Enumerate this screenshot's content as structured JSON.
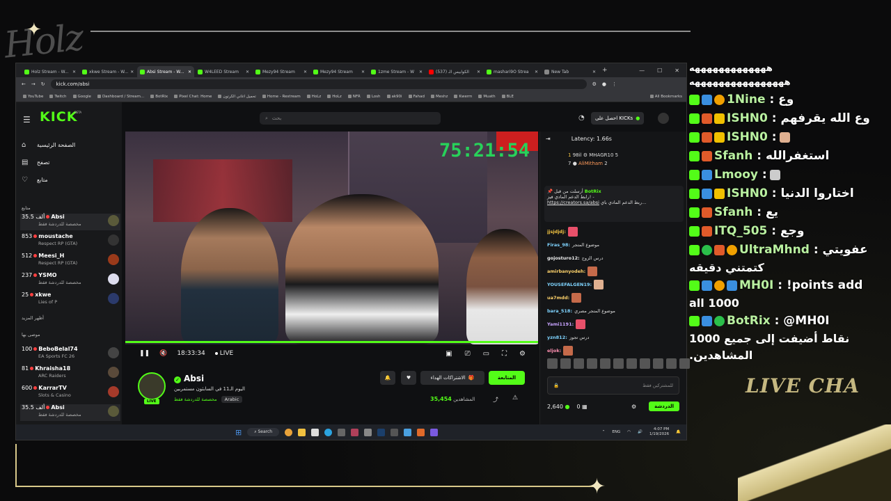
{
  "overlay_logo": "Holz",
  "browser": {
    "tabs": [
      {
        "label": "Holz Stream - W..."
      },
      {
        "label": "xkwe Stream - W..."
      },
      {
        "label": "Absi Stream - W...",
        "active": true
      },
      {
        "label": "W4LEED Stream"
      },
      {
        "label": "Mezy94 Stream"
      },
      {
        "label": "Mezy94 Stream"
      },
      {
        "label": "1zme Stream - W"
      },
      {
        "label": "الكوابيس الـ (537)"
      },
      {
        "label": "mashari9O Strea"
      },
      {
        "label": "New Tab"
      }
    ],
    "url": "kick.com/absi",
    "bookmarks": [
      "YouTube",
      "Twitch",
      "Google",
      "Dashboard / Stream...",
      "BotRix",
      "Pixel Chat: Home",
      "تحميل اغاني الكرتون",
      "Home - Restream",
      "HoLz",
      "HoLz",
      "NFR",
      "Losh",
      "ak90i",
      "Fahad",
      "Meshz",
      "Kwerm",
      "Muath",
      "BLE"
    ],
    "all_bookmarks": "All Bookmarks"
  },
  "kick": {
    "logo": "KICK",
    "beta": "BETA",
    "search_placeholder": "بحث",
    "kicks_button": "احصل على KICKs",
    "nav": [
      {
        "label": "الصفحة الرئيسية",
        "icon": "home-icon"
      },
      {
        "label": "تصفح",
        "icon": "browse-icon"
      },
      {
        "label": "متابع",
        "icon": "heart-icon"
      }
    ],
    "following_label": "متابع",
    "show_more": "أظهر المزيد",
    "recommended_label": "موصى بها",
    "following": [
      {
        "count": "35.5 ألف",
        "name": "Absi",
        "sub": "مخصصة للدردشة فقط"
      },
      {
        "count": "853",
        "name": "moustache",
        "sub": "Respect RP (GTA)"
      },
      {
        "count": "512",
        "name": "Meesi_H",
        "sub": "Respect RP (GTA)"
      },
      {
        "count": "237",
        "name": "YSMO",
        "sub": "مخصصة للدردشة فقط"
      },
      {
        "count": "25",
        "name": "xkwe",
        "sub": "Lies of P"
      }
    ],
    "recommended": [
      {
        "count": "100",
        "name": "BeboBelal74",
        "sub": "EA Sports FC 26"
      },
      {
        "count": "81",
        "name": "Khraisha18",
        "sub": "ARC Raiders"
      },
      {
        "count": "600",
        "name": "KarrarTV",
        "sub": "Slots & Casino"
      },
      {
        "count": "35.5 ألف",
        "name": "Absi",
        "sub": "مخصصة للدردشة فقط"
      }
    ],
    "video": {
      "timer": "75:21:54",
      "elapsed": "18:33:34",
      "live": "LIVE"
    },
    "stream": {
      "name": "Absi",
      "title": "اليوم الـ11 في السابثون مستمربين",
      "category": "مخصصة للدردشة فقط",
      "language": "Arabic",
      "live_badge": "LIVE",
      "follow": "المتابعة",
      "subscribe": "الاشتراكات الهداء",
      "viewers_label": "المشاهدين",
      "viewers": "35,454"
    },
    "chat": {
      "latency": "Latency: 1.66s",
      "leaderboard": [
        {
          "rank": "1",
          "points": "98il",
          "name": "MHAGR10",
          "val": "5"
        },
        {
          "rank": "",
          "points": "7",
          "name": "AliMitham",
          "val": "2"
        }
      ],
      "pinned_by": "أرسلت من قبل",
      "pinned_user": "BotRix",
      "pinned_text": "رابط الدعم المادي فيز! -",
      "pinned_link": "https://creators.sa/absi",
      "pinned_tail": "ربط الدعم المادي باي...",
      "messages": [
        {
          "user": "jjsjdjdj:",
          "text": "",
          "color": "#f4c542"
        },
        {
          "user": "Firas_98:",
          "text": "موضوع المتجر",
          "color": "#7fd4ff"
        },
        {
          "user": "gojosturo12:",
          "text": "درس الزوج",
          "color": "#eee"
        },
        {
          "user": "amirbanyodeh:",
          "text": "",
          "color": "#ffd36b"
        },
        {
          "user": "YOUSEFALGEN19:",
          "text": "",
          "color": "#7fd4ff"
        },
        {
          "user": "ua7mdd:",
          "text": "",
          "color": "#ffd36b"
        },
        {
          "user": "bara_518:",
          "text": "موضوع المتجر مصري",
          "color": "#7fd4ff"
        },
        {
          "user": "Yami1191:",
          "text": "",
          "color": "#c7a3ff"
        },
        {
          "user": "yzn812:",
          "text": "درس تجوز",
          "color": "#7fd4ff"
        },
        {
          "user": "eljok:",
          "text": "",
          "color": "#ff8fb0"
        }
      ],
      "input_placeholder": "للمشتركين فقط",
      "points": "2,640",
      "zero": "0",
      "send": "الدردشة"
    }
  },
  "taskbar": {
    "search": "Search",
    "lang": "ENG",
    "time": "4:07 PM",
    "date": "1/19/2026"
  },
  "overlay_chat": [
    {
      "text": "هههههههههههههه"
    },
    {
      "text": "ههههههههههههههههه"
    },
    {
      "user": "1Nine",
      "text": ": وع"
    },
    {
      "user": "ISHN0",
      "text": ": وع الله يقرفهم"
    },
    {
      "user": "ISHN0",
      "text": ":"
    },
    {
      "user": "Sfanh",
      "text": ": استغفرالله"
    },
    {
      "user": "Lmooy",
      "text": ":"
    },
    {
      "user": "ISHN0",
      "text": ": اختاروا الدنيا"
    },
    {
      "user": "Sfanh",
      "text": ": يع"
    },
    {
      "user": "ITQ_505",
      "text": ": وجع"
    },
    {
      "user": "UltraMhnd",
      "text": ": عفويتي"
    },
    {
      "text": "كتمتني دقيقه"
    },
    {
      "user": "MH0I",
      "text": ": !points add"
    },
    {
      "text": "all 1000"
    },
    {
      "user": "BotRix",
      "text": ": @MH0I"
    },
    {
      "text": "نقاط أضيفت إلى جميع 1000"
    },
    {
      "text": ".المشاهدين"
    }
  ],
  "live_chat_label": "LIVE CHA"
}
